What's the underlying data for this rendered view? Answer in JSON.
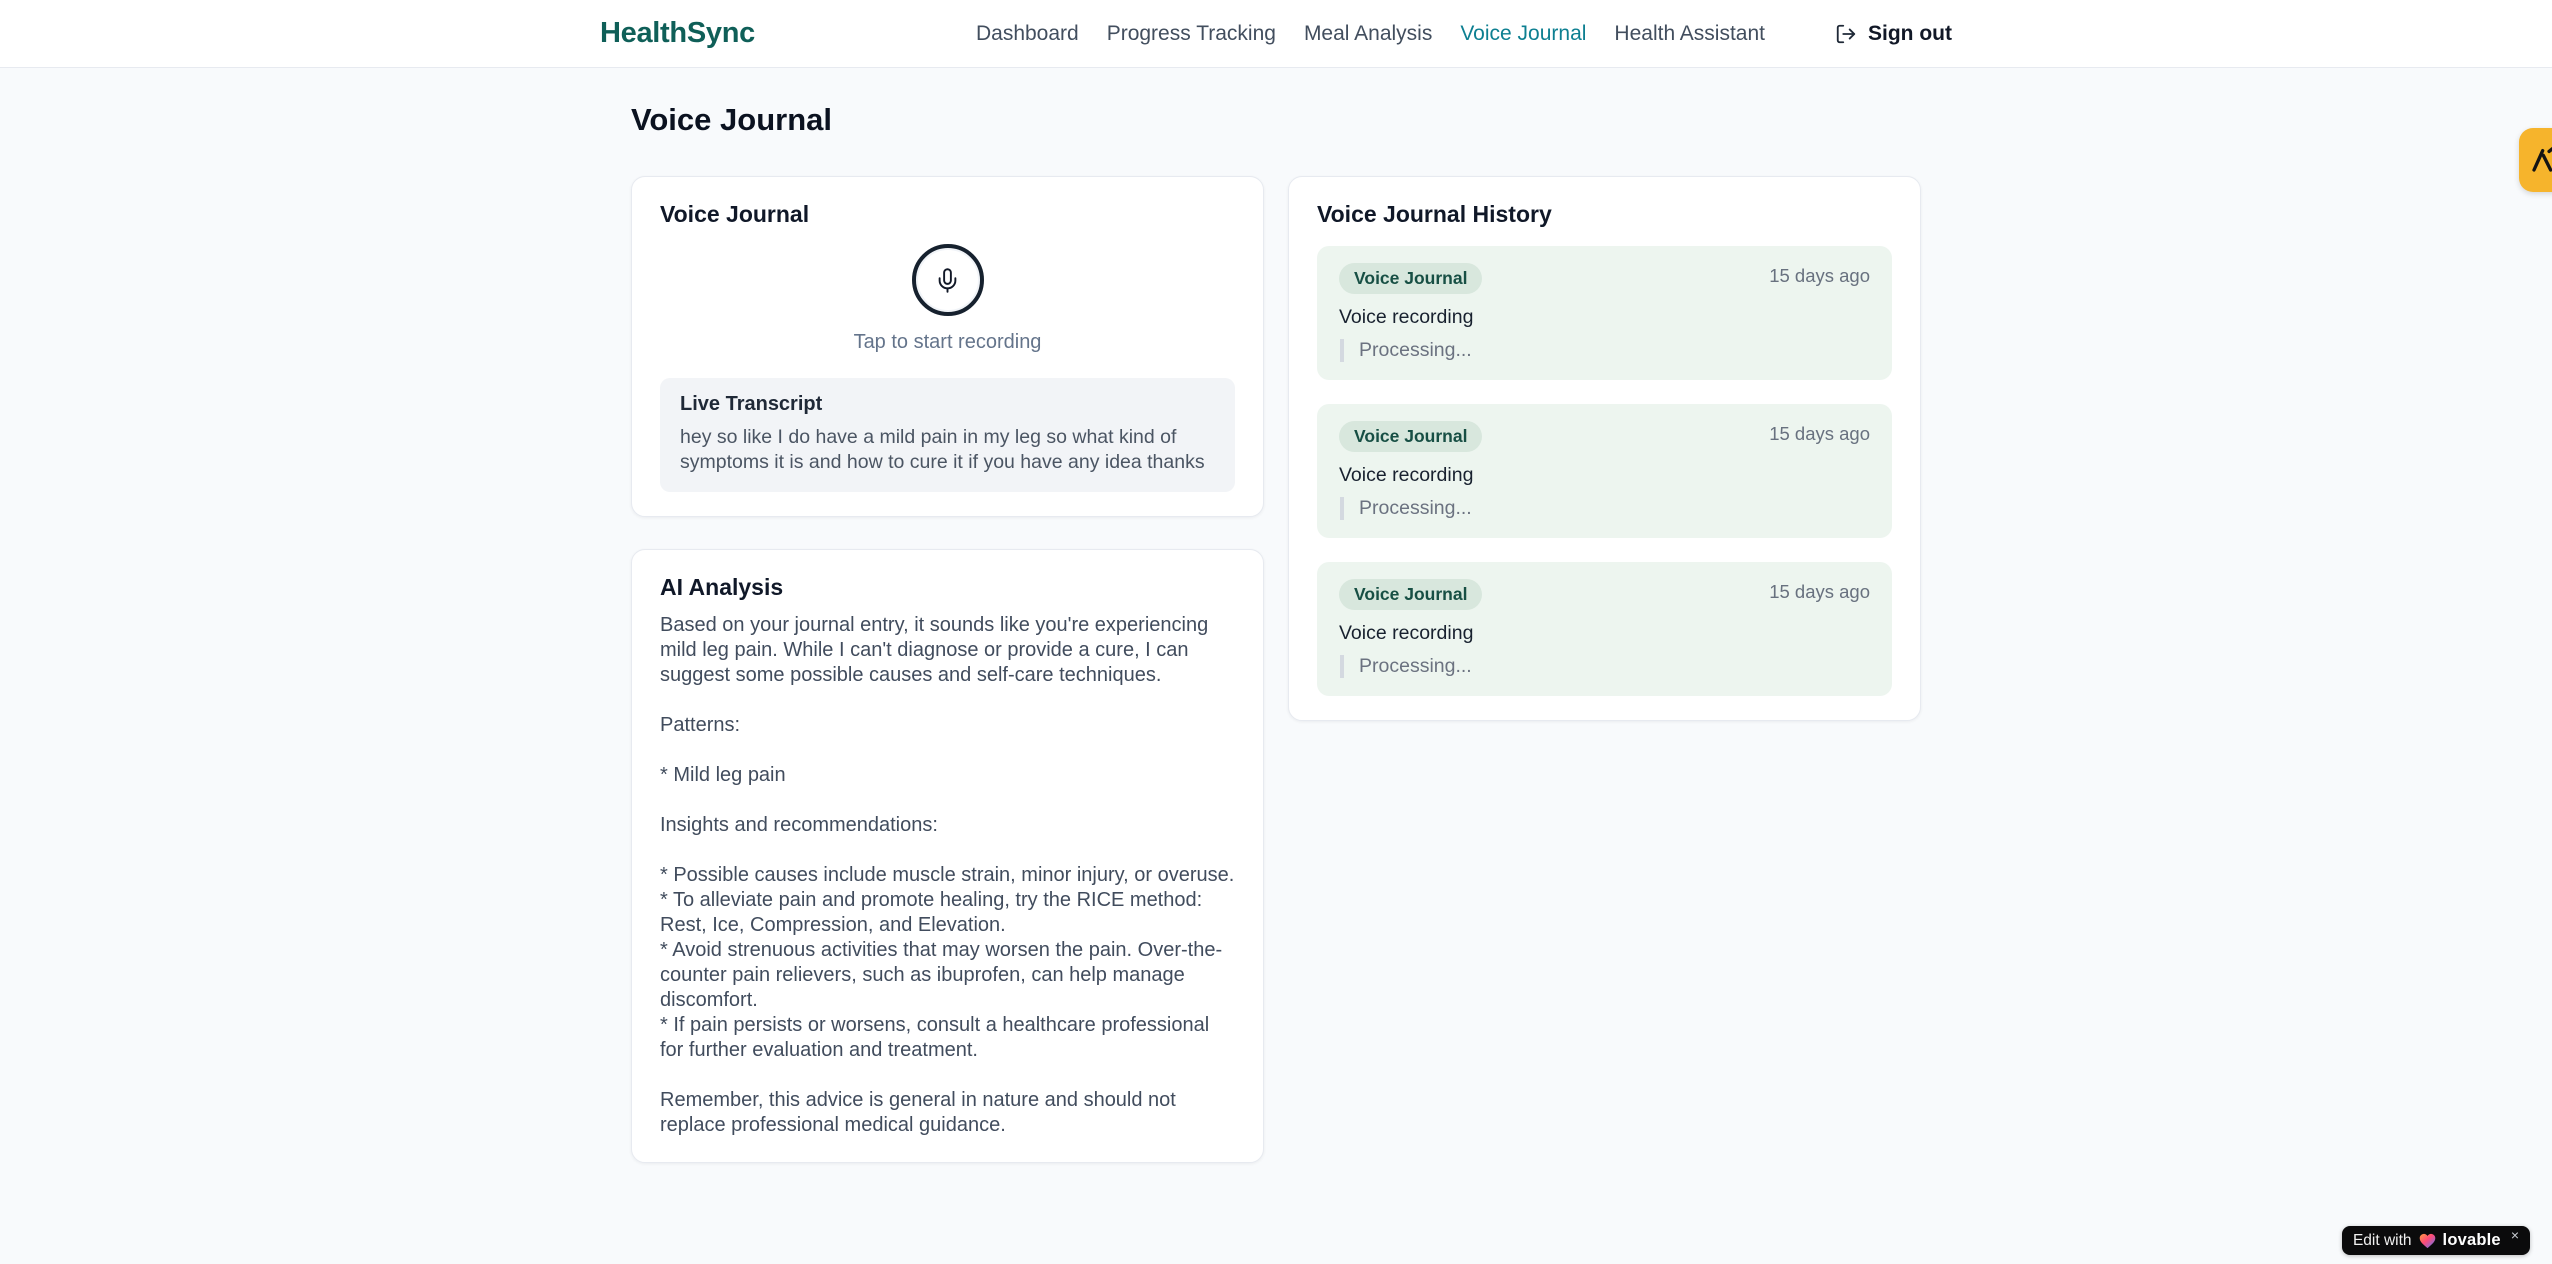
{
  "header": {
    "brand": "HealthSync",
    "nav": [
      {
        "label": "Dashboard",
        "active": false
      },
      {
        "label": "Progress Tracking",
        "active": false
      },
      {
        "label": "Meal Analysis",
        "active": false
      },
      {
        "label": "Voice Journal",
        "active": true
      },
      {
        "label": "Health Assistant",
        "active": false
      }
    ],
    "sign_out_label": "Sign out"
  },
  "page": {
    "title": "Voice Journal"
  },
  "recorder": {
    "card_title": "Voice Journal",
    "tap_hint": "Tap to start recording",
    "transcript_title": "Live Transcript",
    "transcript_text": "hey so like I do have a mild pain in my leg so what kind of symptoms it is and how to cure it if you have any idea thanks"
  },
  "analysis": {
    "card_title": "AI Analysis",
    "body": "Based on your journal entry, it sounds like you're experiencing mild leg pain. While I can't diagnose or provide a cure, I can suggest some possible causes and self-care techniques.\n\nPatterns:\n\n* Mild leg pain\n\nInsights and recommendations:\n\n* Possible causes include muscle strain, minor injury, or overuse.\n* To alleviate pain and promote healing, try the RICE method: Rest, Ice, Compression, and Elevation.\n* Avoid strenuous activities that may worsen the pain. Over-the-counter pain relievers, such as ibuprofen, can help manage discomfort.\n* If pain persists or worsens, consult a healthcare professional for further evaluation and treatment.\n\nRemember, this advice is general in nature and should not replace professional medical guidance."
  },
  "history": {
    "card_title": "Voice Journal History",
    "items": [
      {
        "badge": "Voice Journal",
        "time": "15 days ago",
        "title": "Voice recording",
        "status": "Processing..."
      },
      {
        "badge": "Voice Journal",
        "time": "15 days ago",
        "title": "Voice recording",
        "status": "Processing..."
      },
      {
        "badge": "Voice Journal",
        "time": "15 days ago",
        "title": "Voice recording",
        "status": "Processing..."
      }
    ]
  },
  "widgets": {
    "lovable": {
      "prefix": "Edit with",
      "brand": "lovable",
      "close": "×"
    }
  },
  "icons": {
    "mic": "mic-icon",
    "sign_out": "logout-icon",
    "heart": "gradient-heart-icon",
    "close": "close-icon",
    "side_tab": "agent-logo-icon"
  },
  "colors": {
    "brand_teal": "#0f5f58",
    "nav_active_teal": "#0d7f91",
    "page_background": "#f8fafc",
    "card_border": "#e7eaf0",
    "history_item_bg": "#edf5ef",
    "badge_bg": "#d8e7dd",
    "badge_text": "#174f44",
    "mic_ring": "#16212e",
    "transcript_bg": "#f2f4f7",
    "muted_text": "#6b7280",
    "side_tab_amber": "#f6b42c",
    "lovable_bg": "#0b0b0c"
  }
}
